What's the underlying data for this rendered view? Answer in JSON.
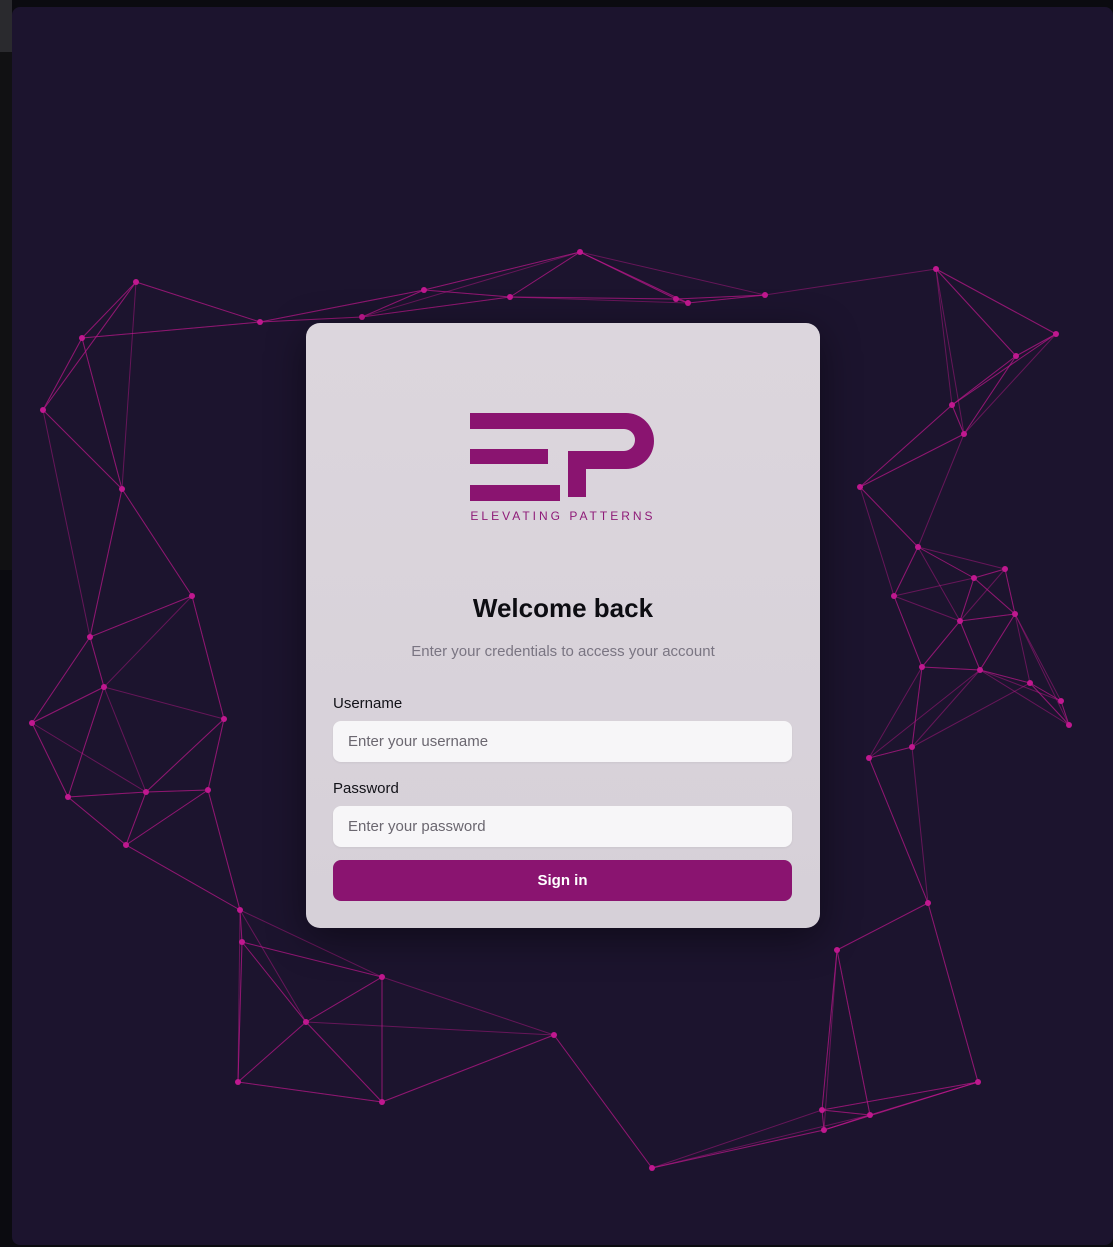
{
  "brand": {
    "tagline": "ELEVATING PATTERNS",
    "accent_color": "#8a1470",
    "background_color": "#1c142e",
    "network_color": "#c0188f"
  },
  "login": {
    "title": "Welcome back",
    "subtitle": "Enter your credentials to access your account",
    "username_label": "Username",
    "username_placeholder": "Enter your username",
    "username_value": "",
    "password_label": "Password",
    "password_placeholder": "Enter your password",
    "password_value": "",
    "signin_label": "Sign in"
  },
  "icons": {
    "logo": "ep-logo-icon"
  }
}
